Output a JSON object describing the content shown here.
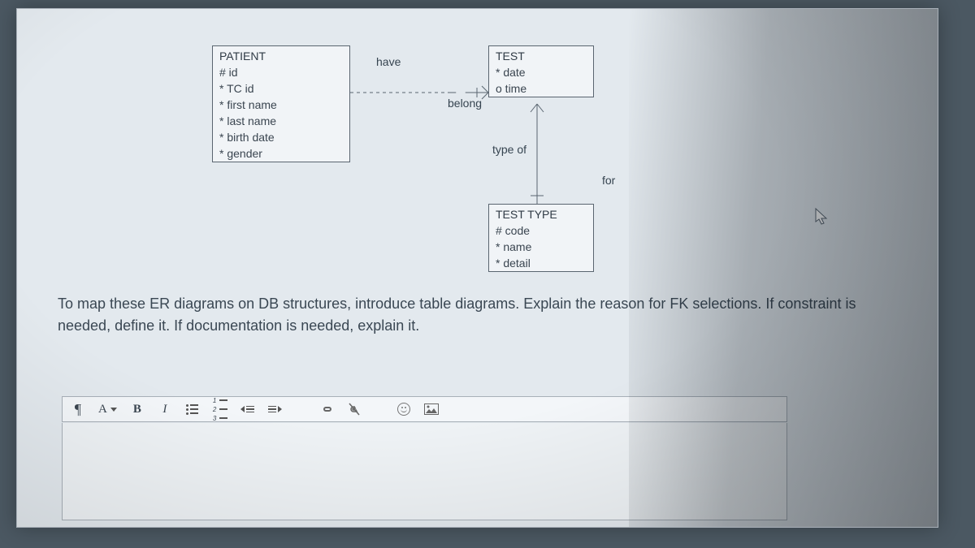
{
  "diagram": {
    "entities": {
      "patient": {
        "title": "PATIENT",
        "attrs": [
          "# id",
          "* TC id",
          "* first name",
          "* last name",
          "* birth date",
          "* gender"
        ]
      },
      "test": {
        "title": "TEST",
        "attrs": [
          "* date",
          "o time"
        ]
      },
      "testtype": {
        "title": "TEST TYPE",
        "attrs": [
          "# code",
          "* name",
          "* detail"
        ]
      }
    },
    "labels": {
      "have": "have",
      "belong": "belong",
      "typeof": "type of",
      "for": "for"
    }
  },
  "prompt_text": "To map these ER diagrams on DB structures, introduce table diagrams. Explain the reason for FK selections. If constraint is needed, define it.  If documentation is needed, explain it.",
  "toolbar": {
    "paragraph_label": "¶",
    "font_label": "A",
    "bold_label": "B",
    "italic_label": "I"
  }
}
